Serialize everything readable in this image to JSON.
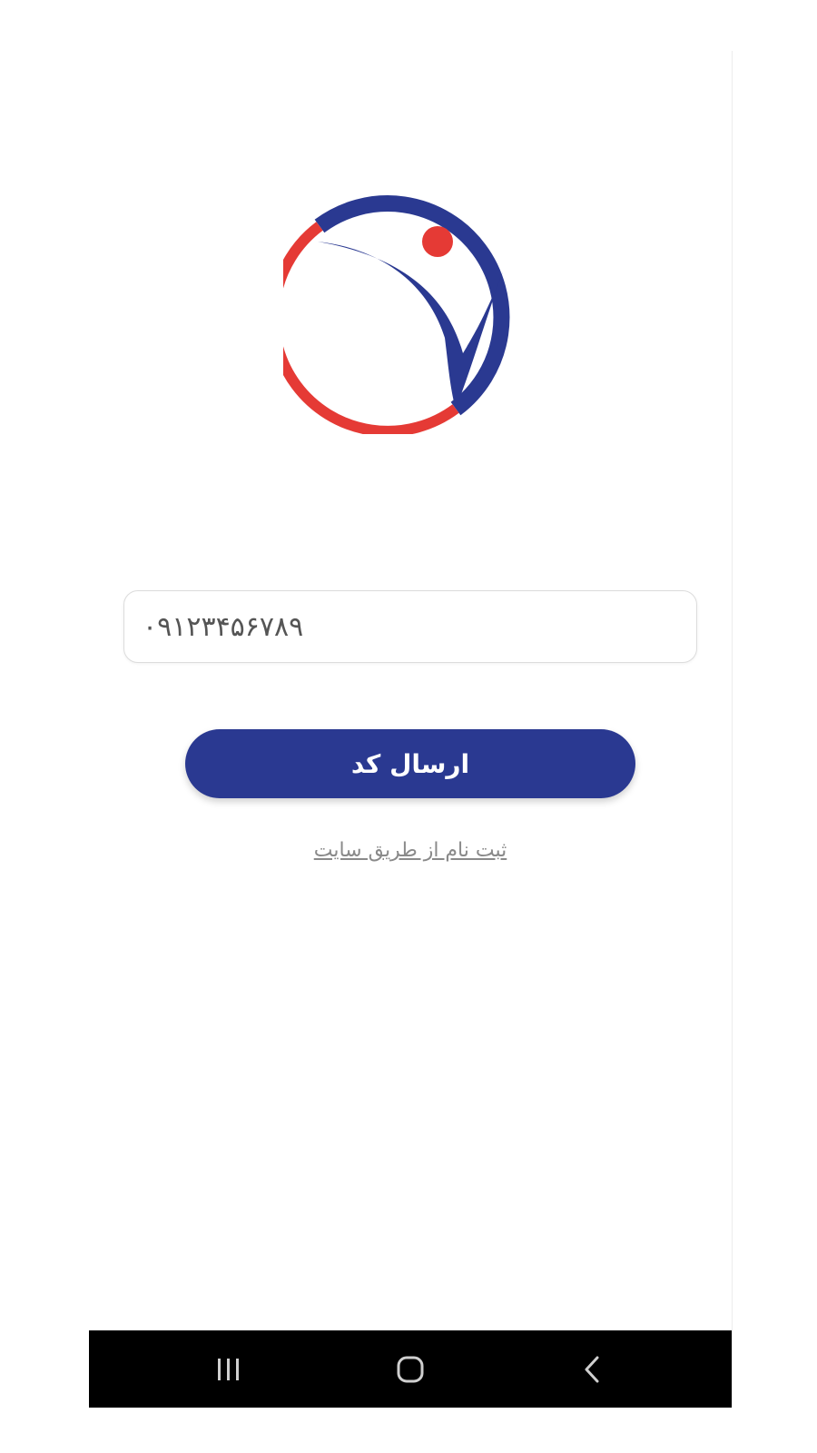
{
  "login": {
    "phone_value": "۰۹۱۲۳۴۵۶۷۸۹",
    "send_code_label": "ارسال کد",
    "register_link_label": "ثبت نام از طریق سایت"
  },
  "colors": {
    "brand_blue": "#2a3991",
    "brand_red": "#e53a35",
    "nav_background": "#000000"
  },
  "icons": {
    "logo": "logo-icon",
    "recent_apps": "recent-apps-icon",
    "home": "home-icon",
    "back": "back-icon"
  }
}
